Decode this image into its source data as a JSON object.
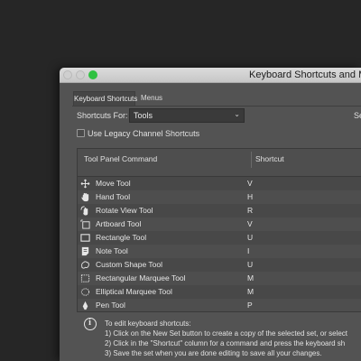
{
  "window": {
    "title": "Keyboard Shortcuts and Menus"
  },
  "tabs": [
    {
      "label": "Keyboard Shortcuts"
    },
    {
      "label": "Menus"
    }
  ],
  "shortcuts_for": {
    "label": "Shortcuts For:",
    "value": "Tools",
    "set_label": "Se"
  },
  "legacy_checkbox": {
    "label": "Use Legacy Channel Shortcuts",
    "checked": false
  },
  "table": {
    "headers": {
      "command": "Tool Panel Command",
      "shortcut": "Shortcut"
    },
    "rows": [
      {
        "name": "Move Tool",
        "shortcut": "V",
        "icon": "move-icon"
      },
      {
        "name": "Hand Tool",
        "shortcut": "H",
        "icon": "hand-icon"
      },
      {
        "name": "Rotate View Tool",
        "shortcut": "R",
        "icon": "rotate-view-icon"
      },
      {
        "name": "Artboard Tool",
        "shortcut": "V",
        "icon": "artboard-icon"
      },
      {
        "name": "Rectangle Tool",
        "shortcut": "U",
        "icon": "rectangle-icon"
      },
      {
        "name": "Note Tool",
        "shortcut": "I",
        "icon": "note-icon"
      },
      {
        "name": "Custom Shape Tool",
        "shortcut": "U",
        "icon": "custom-shape-icon"
      },
      {
        "name": "Rectangular Marquee Tool",
        "shortcut": "M",
        "icon": "rectangular-marquee-icon"
      },
      {
        "name": "Elliptical Marquee Tool",
        "shortcut": "M",
        "icon": "elliptical-marquee-icon"
      },
      {
        "name": "Pen Tool",
        "shortcut": "P",
        "icon": "pen-icon"
      }
    ]
  },
  "info": {
    "heading": "To edit keyboard shortcuts:",
    "lines": [
      "1) Click on the New Set button to create a copy of the selected set, or select",
      "2) Click in the \"Shortcut\" column for a command and press the keyboard sh",
      "3) Save the set when you are done editing to save all your changes."
    ]
  }
}
